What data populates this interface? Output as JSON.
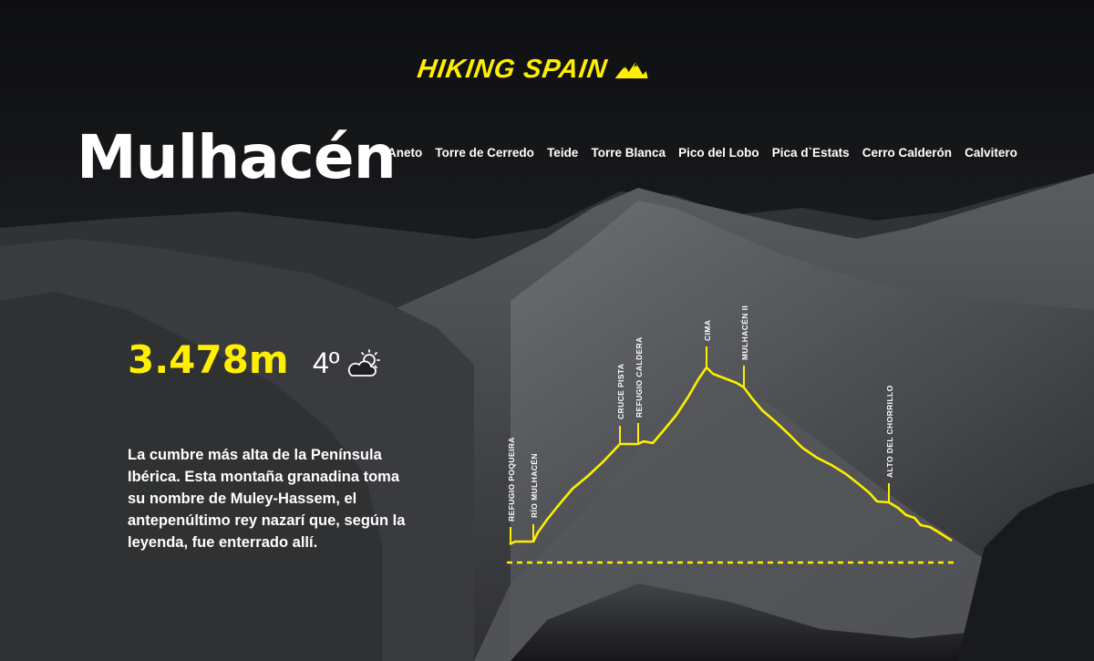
{
  "brand": {
    "name": "HIKING SPAIN",
    "icon": "mountains-icon",
    "color": "#ffee00"
  },
  "mountain": {
    "name": "Mulhacén",
    "elevation": "3.478m",
    "temperature": "4º",
    "weather_icon": "partly-cloudy-icon",
    "description": "La cumbre más alta de la Península Ibérica. Esta montaña granadina toma su nombre de Muley-Hassem, el antepenúltimo rey nazarí que, según la leyenda, fue enterrado allí."
  },
  "nav": {
    "items": [
      {
        "label": "Aneto"
      },
      {
        "label": "Torre de Cerredo"
      },
      {
        "label": "Teide"
      },
      {
        "label": "Torre Blanca"
      },
      {
        "label": "Pico del Lobo"
      },
      {
        "label": "Pica d`Estats"
      },
      {
        "label": "Cerro Calderón"
      },
      {
        "label": "Calvitero"
      }
    ]
  },
  "route": {
    "line_color": "#ffee00",
    "waypoints": [
      {
        "label": "REFUGIO POQUEIRA"
      },
      {
        "label": "RÍO MULHACÉN"
      },
      {
        "label": "CRUCE PISTA"
      },
      {
        "label": "REFUGIO CALDERA"
      },
      {
        "label": "CIMA"
      },
      {
        "label": "MULHACÉN II"
      },
      {
        "label": "ALTO DEL CHORRILLO"
      }
    ]
  }
}
